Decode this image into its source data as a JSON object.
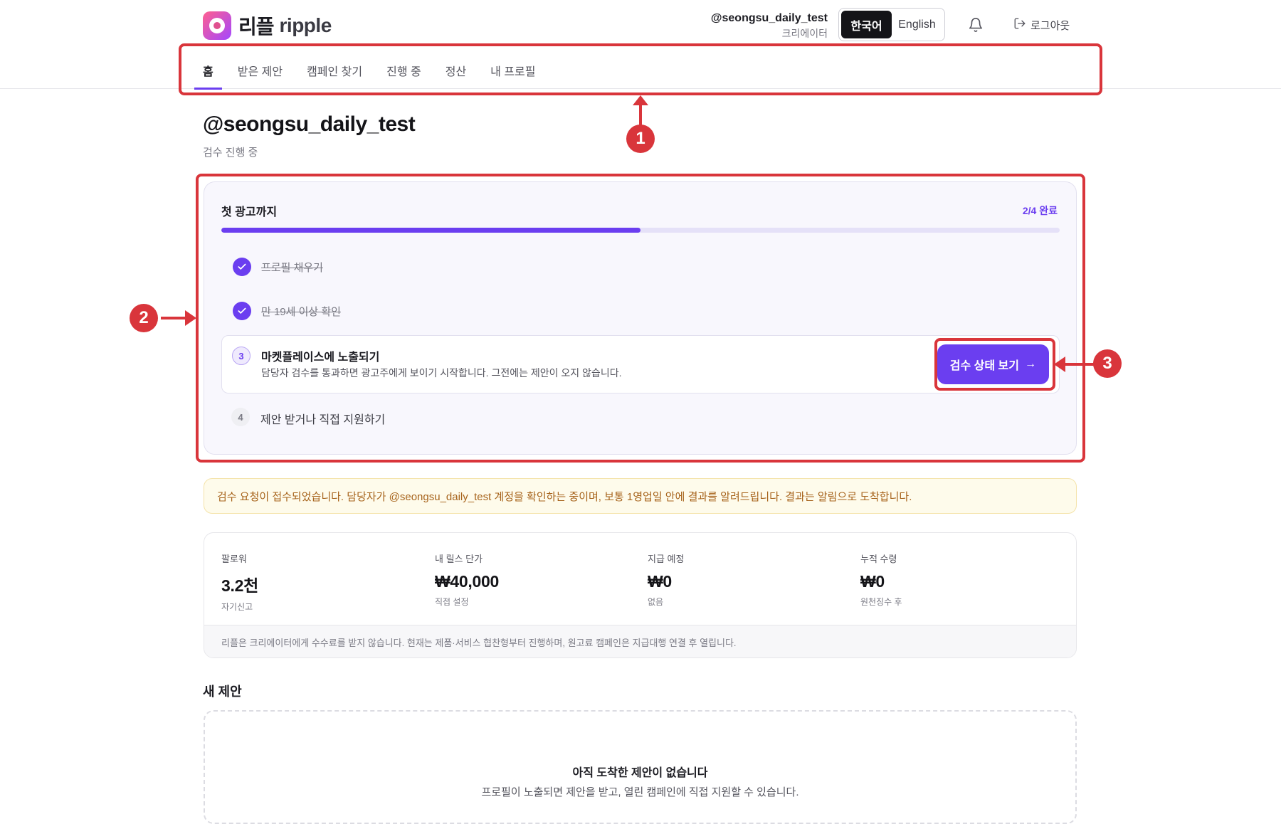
{
  "brand": {
    "name_ko": "리플",
    "name_en": "ripple",
    "gradient": [
      "#ff5f8f",
      "#a347ff"
    ]
  },
  "user": {
    "handle": "@seongsu_daily_test",
    "role": "크리에이터"
  },
  "language": {
    "korean": "한국어",
    "english": "English",
    "selected": "한국어"
  },
  "header": {
    "logout_label": "로그아웃",
    "bell_icon": "bell-icon",
    "logout_icon": "logout-icon"
  },
  "nav": {
    "items": [
      {
        "label": "홈",
        "active": true
      },
      {
        "label": "받은 제안"
      },
      {
        "label": "캠페인 찾기"
      },
      {
        "label": "진행 중"
      },
      {
        "label": "정산"
      },
      {
        "label": "내 프로필"
      }
    ]
  },
  "page": {
    "title": "@seongsu_daily_test",
    "subtitle": "검수 진행 중"
  },
  "onboarding": {
    "title": "첫 광고까지",
    "progress_text": "2/4 완료",
    "progress_fraction": 0.5,
    "accent": "#6b3ef0",
    "steps": [
      {
        "label": "프로필 채우기",
        "status": "done"
      },
      {
        "label": "만 19세 이상 확인",
        "status": "done"
      },
      {
        "number": "3",
        "label": "마켓플레이스에 노출되기",
        "description": "담당자 검수를 통과하면 광고주에게 보이기 시작합니다. 그전에는 제안이 오지 않습니다.",
        "status": "current",
        "action_label": "검수 상태 보기",
        "action_icon": "arrow-right-icon"
      },
      {
        "number": "4",
        "label": "제안 받거나 직접 지원하기",
        "status": "pending"
      }
    ]
  },
  "notice": {
    "text": "검수 요청이 접수되었습니다. 담당자가 @seongsu_daily_test 계정을 확인하는 중이며, 보통 1영업일 안에 결과를 알려드립니다. 결과는 알림으로 도착합니다."
  },
  "stats": {
    "items": [
      {
        "label": "팔로워",
        "value": "3.2천",
        "note": "자기신고"
      },
      {
        "label": "내 릴스 단가",
        "value": "₩40,000",
        "note": "직접 설정"
      },
      {
        "label": "지급 예정",
        "value": "₩0",
        "note": "없음"
      },
      {
        "label": "누적 수령",
        "value": "₩0",
        "note": "원천징수 후"
      }
    ],
    "footer": "리플은 크리에이터에게 수수료를 받지 않습니다. 현재는 제품·서비스 협찬형부터 진행하며, 원고료 캠페인은 지급대행 연결 후 열립니다."
  },
  "new_offers": {
    "title": "새 제안",
    "empty_title": "아직 도착한 제안이 없습니다",
    "empty_desc": "프로필이 노출되면 제안을 받고, 열린 캠페인에 직접 지원할 수 있습니다."
  },
  "annotations": {
    "color": "#d9353b",
    "labels": [
      "1",
      "2",
      "3"
    ]
  }
}
